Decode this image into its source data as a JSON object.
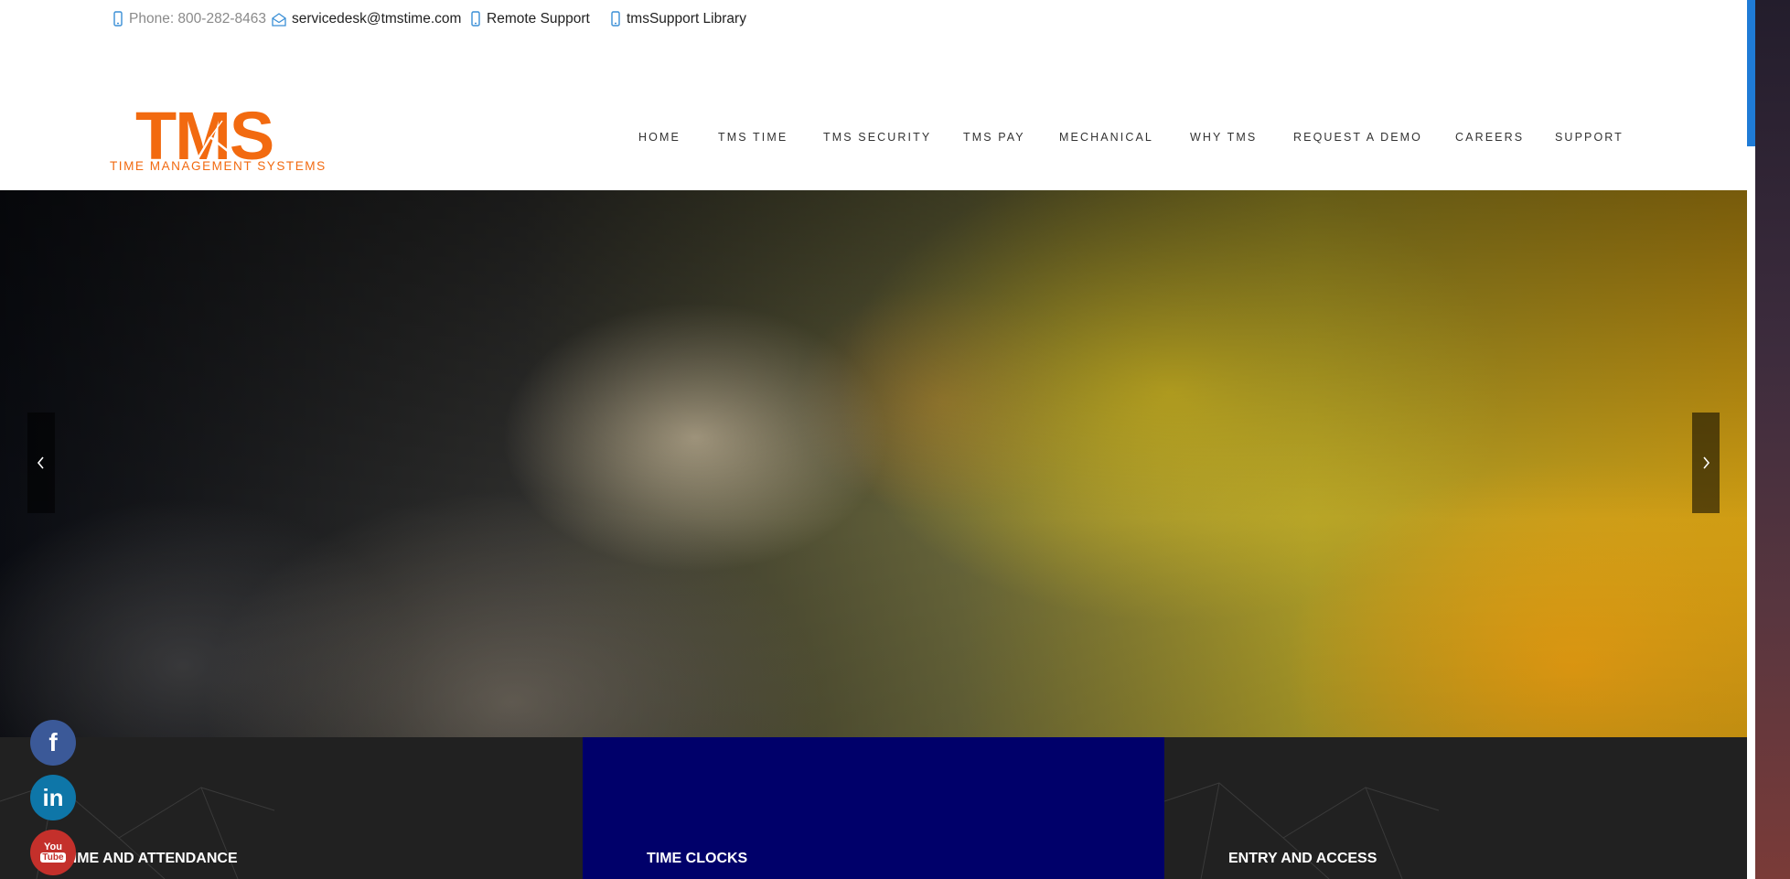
{
  "topbar": {
    "phone": "Phone: 800-282-8463",
    "email": "servicedesk@tmstime.com",
    "remote_support": "Remote Support",
    "library": "tmsSupport Library"
  },
  "logo": {
    "text": "TMS",
    "tagline": "TIME MANAGEMENT SYSTEMS",
    "color": "#f26a10"
  },
  "nav": {
    "items": [
      "HOME",
      "TMS TIME",
      "TMS SECURITY",
      "TMS PAY",
      "MECHANICAL",
      "WHY TMS",
      "REQUEST A DEMO",
      "CAREERS",
      "SUPPORT"
    ]
  },
  "hero": {
    "prev_icon": "chevron-left-icon",
    "next_icon": "chevron-right-icon"
  },
  "features": {
    "panels": [
      {
        "title": "TIME AND ATTENDANCE",
        "bg": "#212121"
      },
      {
        "title": "TIME CLOCKS",
        "bg": "#00006a"
      },
      {
        "title": "ENTRY AND ACCESS",
        "bg": "#212121"
      }
    ]
  },
  "social": {
    "facebook": {
      "label": "f",
      "color": "#3b5998"
    },
    "linkedin": {
      "label": "in",
      "color": "#0e76a8"
    },
    "youtube": {
      "label_top": "You",
      "label_bottom": "Tube",
      "color": "#c4302b"
    }
  },
  "colors": {
    "accent_orange": "#f26a10",
    "scroll_accent": "#1f7bd6"
  }
}
